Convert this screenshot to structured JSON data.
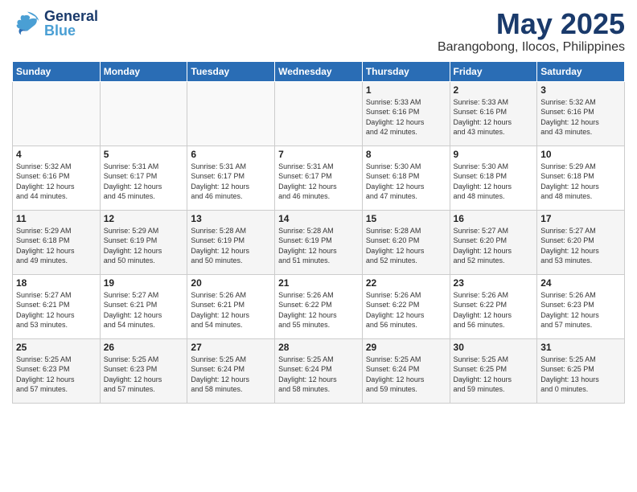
{
  "header": {
    "logo_general": "General",
    "logo_blue": "Blue",
    "month": "May 2025",
    "location": "Barangobong, Ilocos, Philippines"
  },
  "days_of_week": [
    "Sunday",
    "Monday",
    "Tuesday",
    "Wednesday",
    "Thursday",
    "Friday",
    "Saturday"
  ],
  "weeks": [
    [
      {
        "day": "",
        "info": ""
      },
      {
        "day": "",
        "info": ""
      },
      {
        "day": "",
        "info": ""
      },
      {
        "day": "",
        "info": ""
      },
      {
        "day": "1",
        "info": "Sunrise: 5:33 AM\nSunset: 6:16 PM\nDaylight: 12 hours\nand 42 minutes."
      },
      {
        "day": "2",
        "info": "Sunrise: 5:33 AM\nSunset: 6:16 PM\nDaylight: 12 hours\nand 43 minutes."
      },
      {
        "day": "3",
        "info": "Sunrise: 5:32 AM\nSunset: 6:16 PM\nDaylight: 12 hours\nand 43 minutes."
      }
    ],
    [
      {
        "day": "4",
        "info": "Sunrise: 5:32 AM\nSunset: 6:16 PM\nDaylight: 12 hours\nand 44 minutes."
      },
      {
        "day": "5",
        "info": "Sunrise: 5:31 AM\nSunset: 6:17 PM\nDaylight: 12 hours\nand 45 minutes."
      },
      {
        "day": "6",
        "info": "Sunrise: 5:31 AM\nSunset: 6:17 PM\nDaylight: 12 hours\nand 46 minutes."
      },
      {
        "day": "7",
        "info": "Sunrise: 5:31 AM\nSunset: 6:17 PM\nDaylight: 12 hours\nand 46 minutes."
      },
      {
        "day": "8",
        "info": "Sunrise: 5:30 AM\nSunset: 6:18 PM\nDaylight: 12 hours\nand 47 minutes."
      },
      {
        "day": "9",
        "info": "Sunrise: 5:30 AM\nSunset: 6:18 PM\nDaylight: 12 hours\nand 48 minutes."
      },
      {
        "day": "10",
        "info": "Sunrise: 5:29 AM\nSunset: 6:18 PM\nDaylight: 12 hours\nand 48 minutes."
      }
    ],
    [
      {
        "day": "11",
        "info": "Sunrise: 5:29 AM\nSunset: 6:18 PM\nDaylight: 12 hours\nand 49 minutes."
      },
      {
        "day": "12",
        "info": "Sunrise: 5:29 AM\nSunset: 6:19 PM\nDaylight: 12 hours\nand 50 minutes."
      },
      {
        "day": "13",
        "info": "Sunrise: 5:28 AM\nSunset: 6:19 PM\nDaylight: 12 hours\nand 50 minutes."
      },
      {
        "day": "14",
        "info": "Sunrise: 5:28 AM\nSunset: 6:19 PM\nDaylight: 12 hours\nand 51 minutes."
      },
      {
        "day": "15",
        "info": "Sunrise: 5:28 AM\nSunset: 6:20 PM\nDaylight: 12 hours\nand 52 minutes."
      },
      {
        "day": "16",
        "info": "Sunrise: 5:27 AM\nSunset: 6:20 PM\nDaylight: 12 hours\nand 52 minutes."
      },
      {
        "day": "17",
        "info": "Sunrise: 5:27 AM\nSunset: 6:20 PM\nDaylight: 12 hours\nand 53 minutes."
      }
    ],
    [
      {
        "day": "18",
        "info": "Sunrise: 5:27 AM\nSunset: 6:21 PM\nDaylight: 12 hours\nand 53 minutes."
      },
      {
        "day": "19",
        "info": "Sunrise: 5:27 AM\nSunset: 6:21 PM\nDaylight: 12 hours\nand 54 minutes."
      },
      {
        "day": "20",
        "info": "Sunrise: 5:26 AM\nSunset: 6:21 PM\nDaylight: 12 hours\nand 54 minutes."
      },
      {
        "day": "21",
        "info": "Sunrise: 5:26 AM\nSunset: 6:22 PM\nDaylight: 12 hours\nand 55 minutes."
      },
      {
        "day": "22",
        "info": "Sunrise: 5:26 AM\nSunset: 6:22 PM\nDaylight: 12 hours\nand 56 minutes."
      },
      {
        "day": "23",
        "info": "Sunrise: 5:26 AM\nSunset: 6:22 PM\nDaylight: 12 hours\nand 56 minutes."
      },
      {
        "day": "24",
        "info": "Sunrise: 5:26 AM\nSunset: 6:23 PM\nDaylight: 12 hours\nand 57 minutes."
      }
    ],
    [
      {
        "day": "25",
        "info": "Sunrise: 5:25 AM\nSunset: 6:23 PM\nDaylight: 12 hours\nand 57 minutes."
      },
      {
        "day": "26",
        "info": "Sunrise: 5:25 AM\nSunset: 6:23 PM\nDaylight: 12 hours\nand 57 minutes."
      },
      {
        "day": "27",
        "info": "Sunrise: 5:25 AM\nSunset: 6:24 PM\nDaylight: 12 hours\nand 58 minutes."
      },
      {
        "day": "28",
        "info": "Sunrise: 5:25 AM\nSunset: 6:24 PM\nDaylight: 12 hours\nand 58 minutes."
      },
      {
        "day": "29",
        "info": "Sunrise: 5:25 AM\nSunset: 6:24 PM\nDaylight: 12 hours\nand 59 minutes."
      },
      {
        "day": "30",
        "info": "Sunrise: 5:25 AM\nSunset: 6:25 PM\nDaylight: 12 hours\nand 59 minutes."
      },
      {
        "day": "31",
        "info": "Sunrise: 5:25 AM\nSunset: 6:25 PM\nDaylight: 13 hours\nand 0 minutes."
      }
    ]
  ]
}
